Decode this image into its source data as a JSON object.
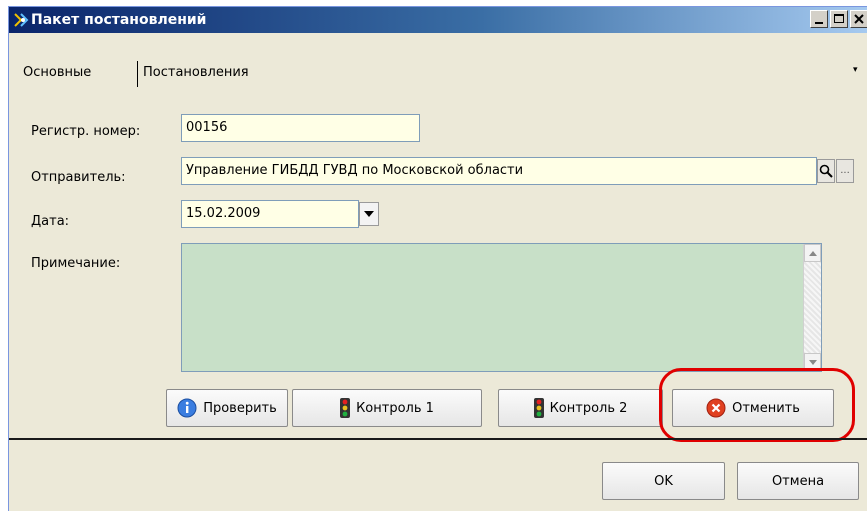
{
  "window": {
    "title": "Пакет постановлений"
  },
  "tabs": [
    {
      "label": "Основные"
    },
    {
      "label": "Постановления"
    }
  ],
  "tabs_menu_icon": "▾",
  "form": {
    "reg_number": {
      "label": "Регистр. номер:",
      "value": "00156"
    },
    "sender": {
      "label": "Отправитель:",
      "value": "Управление ГИБДД ГУВД по Московской области",
      "search_icon": "search-icon",
      "more_icon": "ellipsis-icon",
      "more_label": "..."
    },
    "date": {
      "label": "Дата:",
      "value": "15.02.2009"
    },
    "note": {
      "label": "Примечание:",
      "value": ""
    }
  },
  "actions": {
    "check_label": "Проверить",
    "control1_label": "Контроль 1",
    "control2_label": "Контроль 2",
    "cancel_label": "Отменить"
  },
  "footer": {
    "ok_label": "OK",
    "cancel_label": "Отмена"
  },
  "colors": {
    "field_bg": "#ffffe6",
    "note_bg": "#c8e0c8",
    "highlight": "#e00000",
    "title_bar": "#0a246a"
  }
}
